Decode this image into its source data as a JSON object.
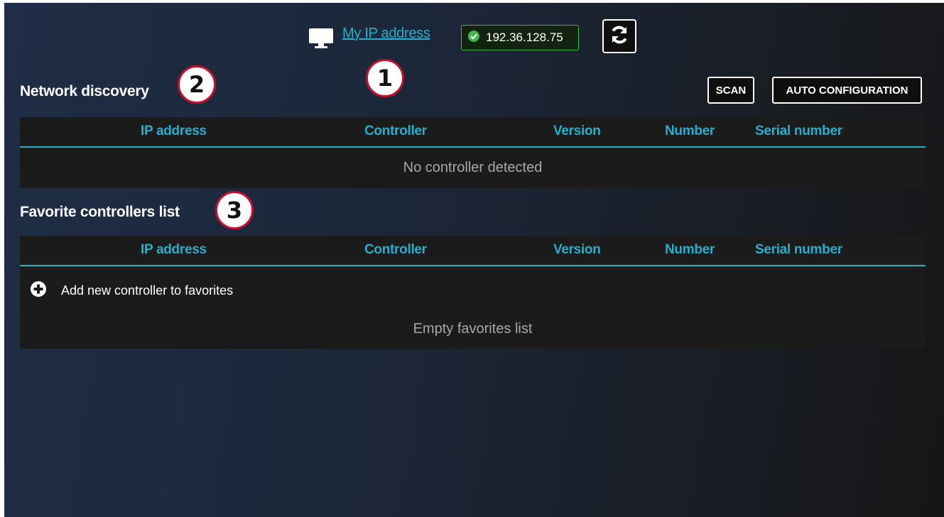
{
  "header": {
    "monitor_icon": "monitor-icon",
    "my_ip_label": "My IP address",
    "ip_value": "192.36.128.75",
    "status_icon": "check-circle-icon",
    "status_color": "#3db94b",
    "refresh_icon": "sync-icon"
  },
  "callouts": [
    "1",
    "2",
    "3"
  ],
  "network_discovery": {
    "title": "Network discovery",
    "scan_label": "SCAN",
    "auto_config_label": "AUTO CONFIGURATION",
    "columns": [
      "IP address",
      "Controller",
      "Version",
      "Number",
      "Serial number"
    ],
    "empty_text": "No controller detected"
  },
  "favorites": {
    "title": "Favorite controllers list",
    "columns": [
      "IP address",
      "Controller",
      "Version",
      "Number",
      "Serial number"
    ],
    "add_label": "Add new controller to favorites",
    "add_icon": "plus-circle-icon",
    "empty_text": "Empty favorites list"
  },
  "colors": {
    "accent": "#29aecb",
    "callout_border": "#c8102e"
  }
}
